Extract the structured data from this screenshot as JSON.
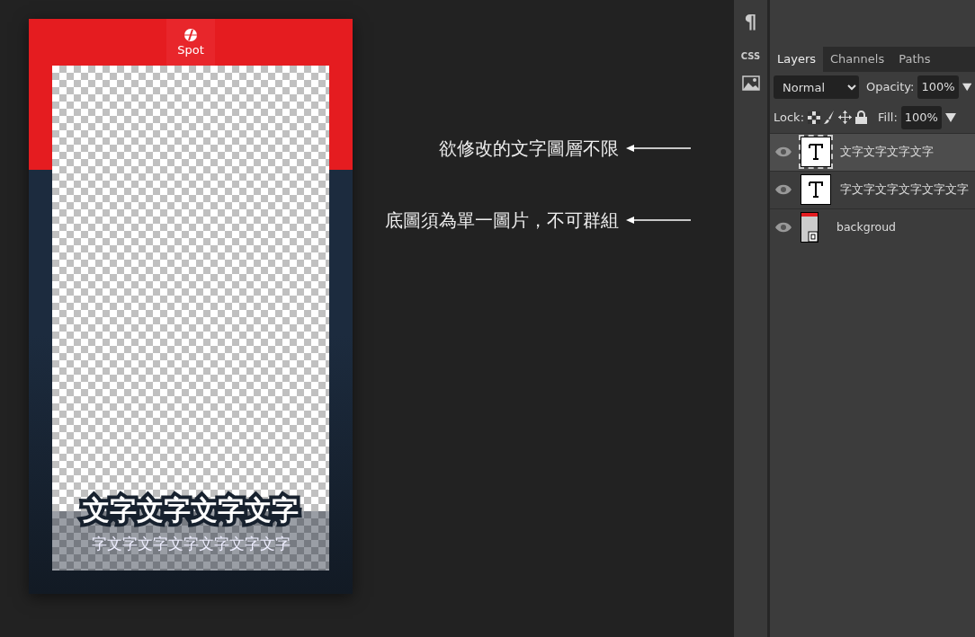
{
  "toolbar": {
    "items": [
      {
        "kind": "glyph",
        "label": "¶"
      },
      {
        "kind": "text",
        "label": "CSS"
      },
      {
        "kind": "image"
      }
    ]
  },
  "canvas": {
    "logo_text": "Spot",
    "title_text": "文字文字文字文字",
    "subtitle_text": "字文字文字文字文字文字文字"
  },
  "annotations": [
    {
      "text": "欲修改的文字圖層不限"
    },
    {
      "text": "底圖須為單一圖片，不可群組"
    }
  ],
  "layers_panel": {
    "tabs": [
      {
        "label": "Layers",
        "selected": true
      },
      {
        "label": "Channels",
        "selected": false
      },
      {
        "label": "Paths",
        "selected": false
      }
    ],
    "blend_mode": "Normal",
    "opacity_label": "Opacity:",
    "opacity": "100%",
    "lock_label": "Lock:",
    "fill_label": "Fill:",
    "fill": "100%",
    "layers": [
      {
        "kind": "text",
        "name": "文字文字文字文字",
        "selected": true,
        "visible": true
      },
      {
        "kind": "text",
        "name": "字文字文字文字文字文字",
        "selected": false,
        "visible": true
      },
      {
        "kind": "image",
        "name": "backgroud",
        "selected": false,
        "visible": true
      }
    ]
  }
}
